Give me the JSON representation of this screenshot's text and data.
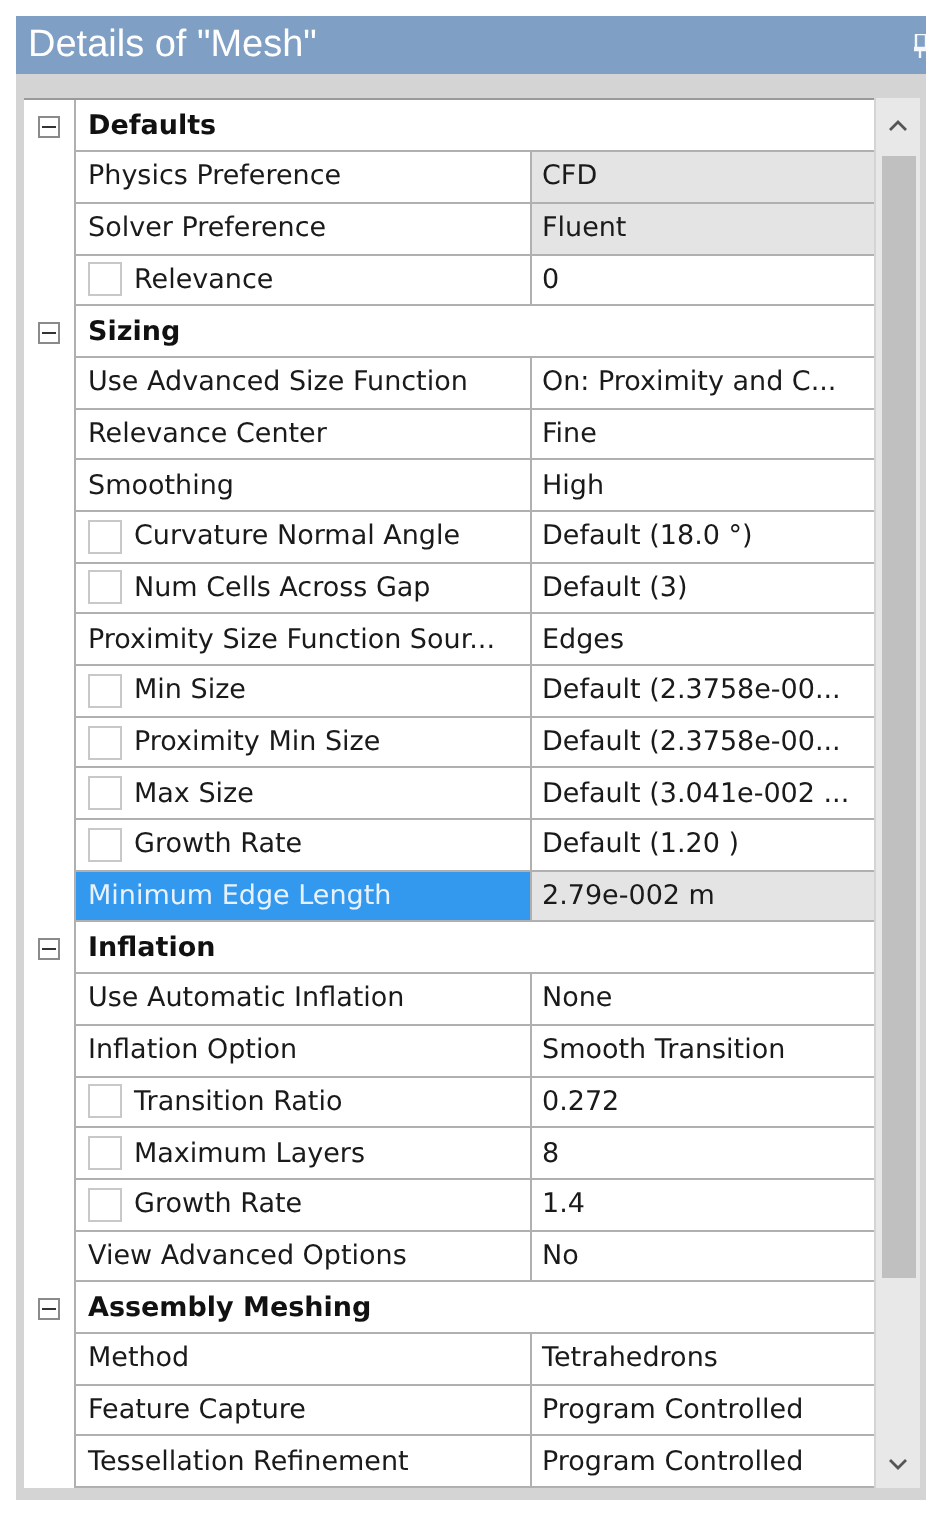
{
  "window": {
    "title": "Details of \"Mesh\""
  },
  "sections": [
    {
      "title": "Defaults",
      "expanded": true,
      "rows": [
        {
          "name": "Physics Preference",
          "value": "CFD",
          "kind": "plain",
          "readonly": true,
          "selected": false
        },
        {
          "name": "Solver Preference",
          "value": "Fluent",
          "kind": "plain",
          "readonly": true,
          "selected": false
        },
        {
          "name": "Relevance",
          "value": "0",
          "kind": "checkbox",
          "checked": false,
          "readonly": false,
          "selected": false
        }
      ]
    },
    {
      "title": "Sizing",
      "expanded": true,
      "rows": [
        {
          "name": "Use Advanced Size Function",
          "value": "On: Proximity and C...",
          "kind": "plain",
          "readonly": false,
          "selected": false
        },
        {
          "name": "Relevance Center",
          "value": "Fine",
          "kind": "plain",
          "readonly": false,
          "selected": false
        },
        {
          "name": "Smoothing",
          "value": "High",
          "kind": "plain",
          "readonly": false,
          "selected": false
        },
        {
          "name": "Curvature Normal Angle",
          "value": "Default (18.0 °)",
          "kind": "checkbox",
          "checked": false,
          "readonly": false,
          "selected": false
        },
        {
          "name": "Num Cells Across Gap",
          "value": "Default (3)",
          "kind": "checkbox",
          "checked": false,
          "readonly": false,
          "selected": false
        },
        {
          "name": "Proximity Size Function Sour...",
          "value": "Edges",
          "kind": "plain",
          "readonly": false,
          "selected": false
        },
        {
          "name": "Min Size",
          "value": "Default (2.3758e-00...",
          "kind": "checkbox",
          "checked": false,
          "readonly": false,
          "selected": false
        },
        {
          "name": "Proximity Min Size",
          "value": "Default (2.3758e-00...",
          "kind": "checkbox",
          "checked": false,
          "readonly": false,
          "selected": false
        },
        {
          "name": "Max Size",
          "value": "Default (3.041e-002 ...",
          "kind": "checkbox",
          "checked": false,
          "readonly": false,
          "selected": false
        },
        {
          "name": "Growth Rate",
          "value": "Default (1.20 )",
          "kind": "checkbox",
          "checked": false,
          "readonly": false,
          "selected": false
        },
        {
          "name": "Minimum Edge Length",
          "value": "2.79e-002 m",
          "kind": "plain",
          "readonly": true,
          "selected": true
        }
      ]
    },
    {
      "title": "Inflation",
      "expanded": true,
      "rows": [
        {
          "name": "Use Automatic Inflation",
          "value": "None",
          "kind": "plain",
          "readonly": false,
          "selected": false
        },
        {
          "name": "Inflation Option",
          "value": "Smooth Transition",
          "kind": "plain",
          "readonly": false,
          "selected": false
        },
        {
          "name": "Transition Ratio",
          "value": "0.272",
          "kind": "checkbox",
          "checked": false,
          "readonly": false,
          "selected": false
        },
        {
          "name": "Maximum Layers",
          "value": "8",
          "kind": "checkbox",
          "checked": false,
          "readonly": false,
          "selected": false
        },
        {
          "name": "Growth Rate",
          "value": "1.4",
          "kind": "checkbox",
          "checked": false,
          "readonly": false,
          "selected": false
        },
        {
          "name": "View Advanced Options",
          "value": "No",
          "kind": "plain",
          "readonly": false,
          "selected": false
        }
      ]
    },
    {
      "title": "Assembly Meshing",
      "expanded": true,
      "rows": [
        {
          "name": "Method",
          "value": "Tetrahedrons",
          "kind": "plain",
          "readonly": false,
          "selected": false
        },
        {
          "name": "Feature Capture",
          "value": "Program Controlled",
          "kind": "plain",
          "readonly": false,
          "selected": false
        },
        {
          "name": "Tessellation Refinement",
          "value": "Program Controlled",
          "kind": "plain",
          "readonly": false,
          "selected": false
        }
      ]
    }
  ]
}
